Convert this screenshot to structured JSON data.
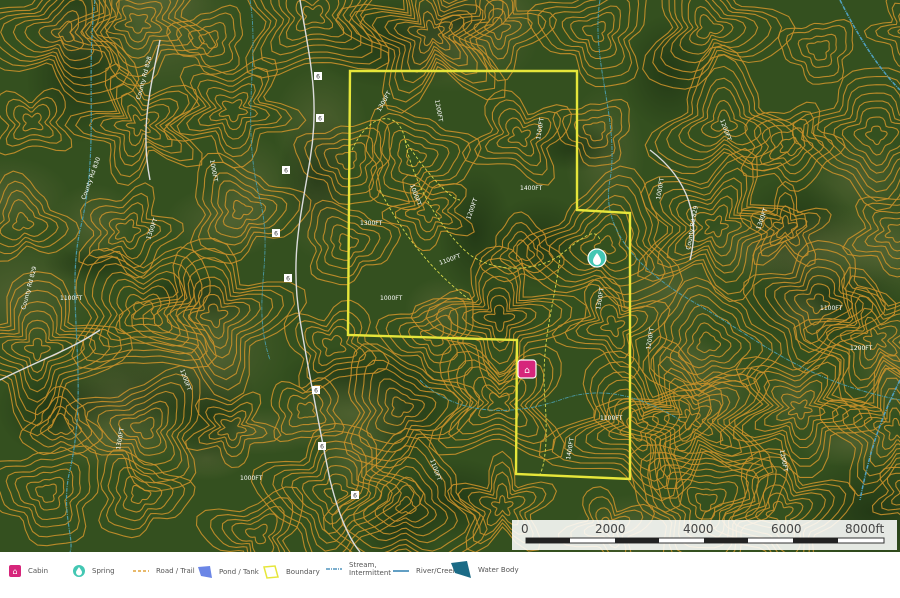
{
  "map": {
    "colors": {
      "forest": "#2f4a1f",
      "forest_dark": "#1f3414",
      "contour": "#c9902a",
      "boundary": "#e6e63a",
      "stream": "#4a9aa6",
      "river": "#2e7fb0"
    },
    "contour_labels": [
      "1300FT",
      "1200FT",
      "1100FT",
      "1000FT",
      "1400FT",
      "1300FT",
      "1200FT",
      "1100FT",
      "1000FT",
      "1300FT",
      "1200FT",
      "1100FT",
      "1400FT",
      "1000FT",
      "1200FT",
      "1300FT",
      "1100FT",
      "1200FT",
      "1000FT",
      "1300FT",
      "1100FT",
      "1200FT",
      "1300FT",
      "1000FT",
      "1100FT",
      "1200FT"
    ],
    "road_labels": [
      "County Rd 830",
      "County Rd 828",
      "County Rd 829",
      "County Rd 829"
    ],
    "road_markers": [
      "6",
      "6",
      "6",
      "6",
      "6",
      "6",
      "6",
      "6"
    ],
    "markers": [
      {
        "type": "Cabin",
        "icon": "cabin-icon"
      },
      {
        "type": "Spring",
        "icon": "spring-icon"
      }
    ]
  },
  "scale": {
    "ticks": [
      "0",
      "2000",
      "4000",
      "6000",
      "8000ft"
    ]
  },
  "legend": [
    {
      "label": "Cabin",
      "icon": "cabin-icon"
    },
    {
      "label": "Spring",
      "icon": "spring-icon"
    },
    {
      "label": "Road / Trail",
      "icon": "road-trail-icon"
    },
    {
      "label": "Pond / Tank",
      "icon": "pond-tank-icon"
    },
    {
      "label": "Boundary",
      "icon": "boundary-icon"
    },
    {
      "label": "Stream, Intermittent",
      "icon": "stream-intermittent-icon"
    },
    {
      "label": "River/Creek",
      "icon": "river-creek-icon"
    },
    {
      "label": "Water Body",
      "icon": "water-body-icon"
    }
  ]
}
